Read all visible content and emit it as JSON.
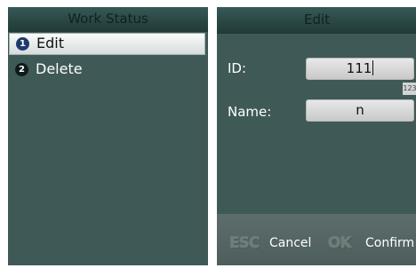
{
  "left_screen": {
    "title": "Work Status",
    "items": [
      {
        "number": "1",
        "label": "Edit",
        "selected": true
      },
      {
        "number": "2",
        "label": "Delete",
        "selected": false
      }
    ]
  },
  "right_screen": {
    "title": "Edit",
    "fields": [
      {
        "label": "ID:",
        "value": "111",
        "has_caret": true
      },
      {
        "label": "Name:",
        "value": "n",
        "has_caret": false
      }
    ],
    "input_mode": "123",
    "buttons": {
      "cancel_key": "ESC",
      "cancel_label": "Cancel",
      "confirm_key": "OK",
      "confirm_label": "Confirm"
    }
  },
  "colors": {
    "screen_bg": "#3f5956",
    "title_bar": "#2a4744",
    "selected_row": "#e8ecec",
    "bottom_bar": "#566866"
  }
}
